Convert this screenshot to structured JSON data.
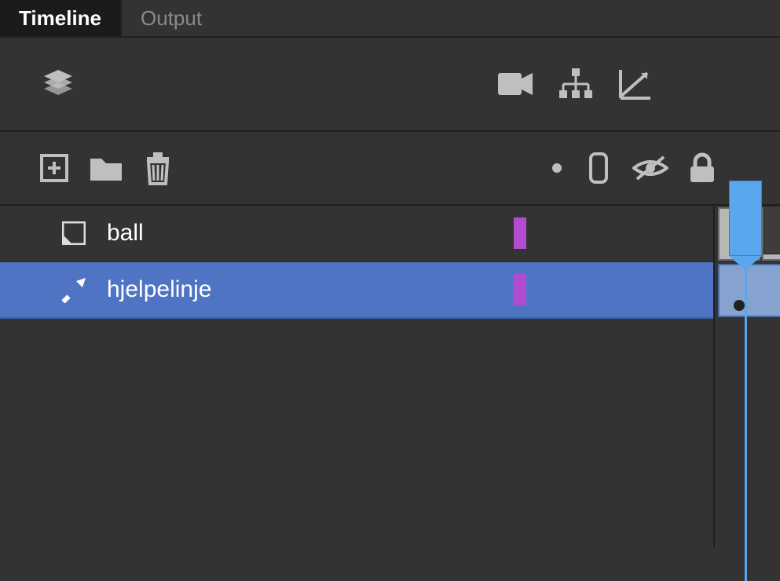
{
  "tabs": {
    "timeline": "Timeline",
    "output": "Output",
    "active": "timeline"
  },
  "layers": [
    {
      "name": "ball",
      "type": "layer",
      "selected": false,
      "color": "#b34bd0"
    },
    {
      "name": "hjelpelinje",
      "type": "guide",
      "selected": true,
      "color": "#b34bd0"
    }
  ],
  "playhead_frame": 1,
  "colors": {
    "selection": "#4f74c4",
    "playhead": "#5aa7ee",
    "layer_color_chip": "#b34bd0",
    "panel_background": "#333333"
  }
}
